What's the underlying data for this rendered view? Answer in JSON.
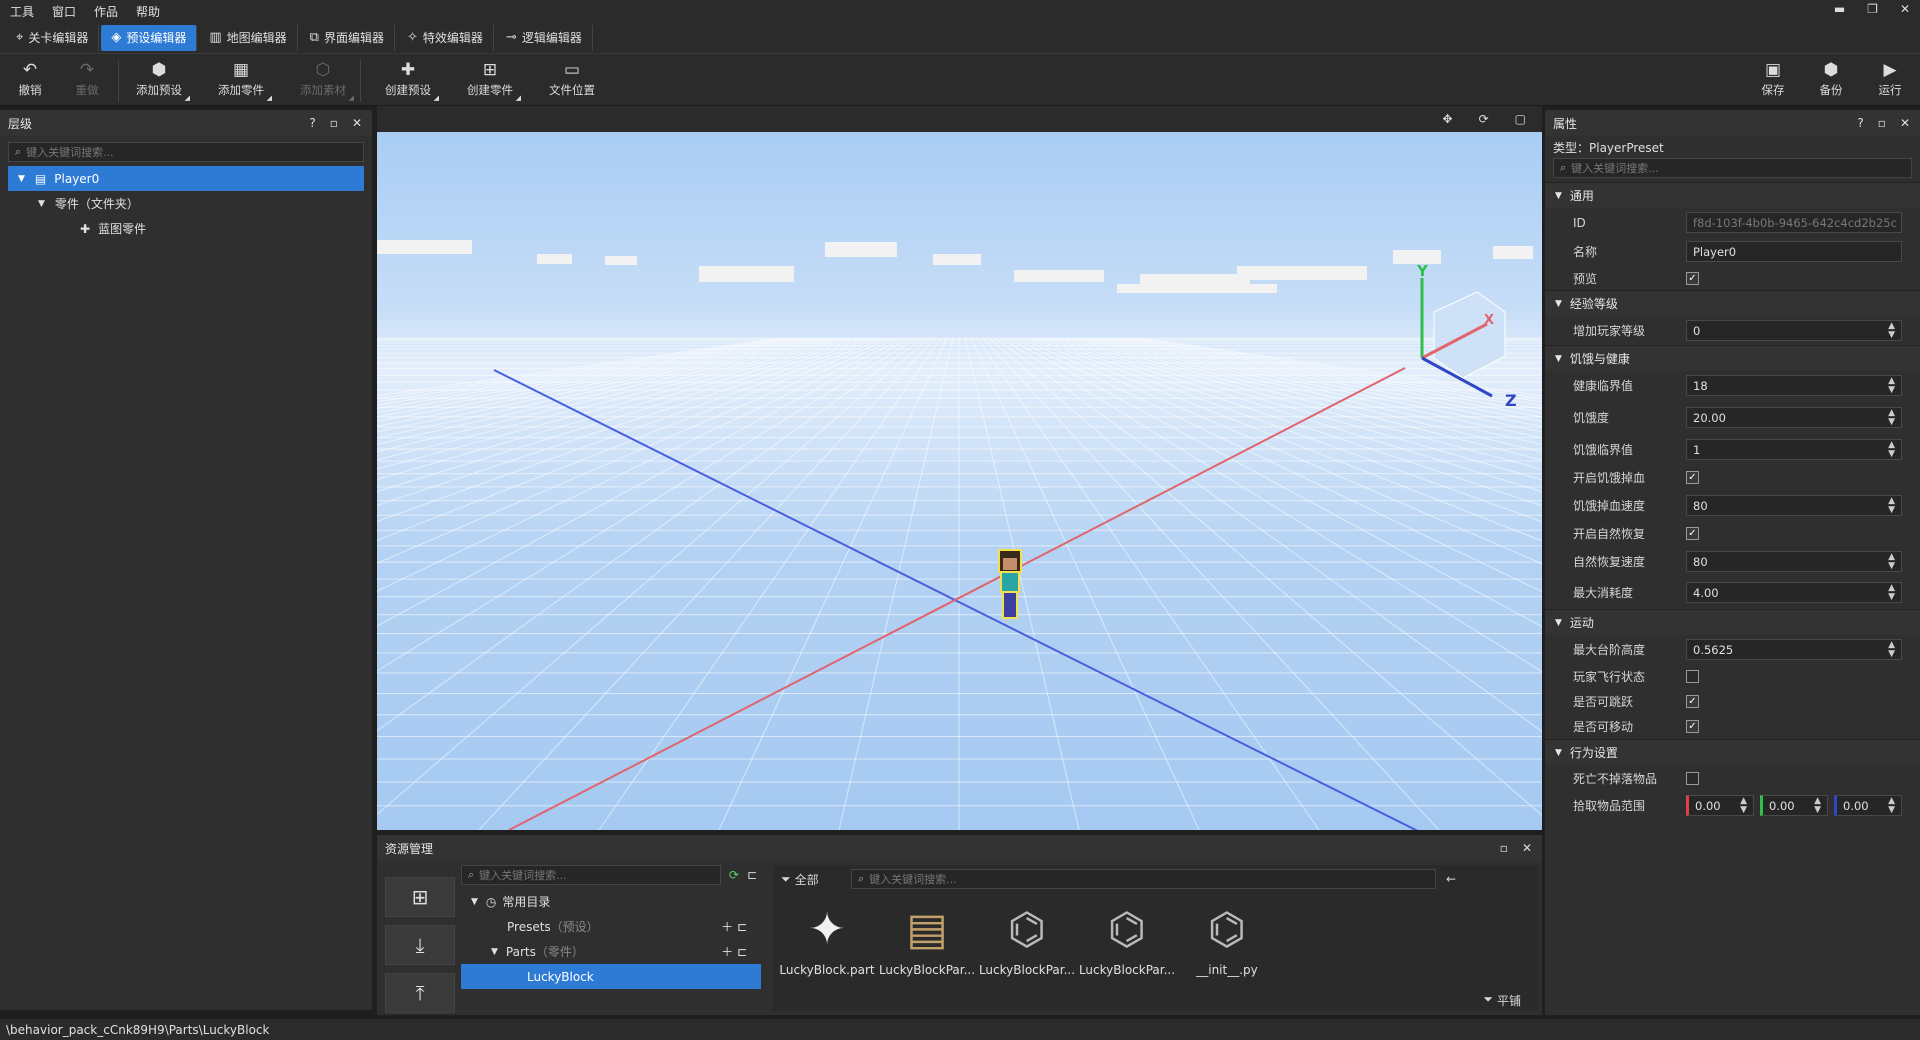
{
  "menubar": {
    "items": [
      "工具",
      "窗口",
      "作品",
      "帮助"
    ],
    "window_controls": [
      "▬",
      "❐",
      "✕"
    ]
  },
  "tabs": [
    {
      "label": "关卡编辑器",
      "icon": "level-editor-icon",
      "active": false
    },
    {
      "label": "预设编辑器",
      "icon": "preset-editor-icon",
      "active": true
    },
    {
      "label": "地图编辑器",
      "icon": "map-editor-icon",
      "active": false
    },
    {
      "label": "界面编辑器",
      "icon": "ui-editor-icon",
      "active": false
    },
    {
      "label": "特效编辑器",
      "icon": "effect-editor-icon",
      "active": false
    },
    {
      "label": "逻辑编辑器",
      "icon": "logic-editor-icon",
      "active": false
    }
  ],
  "toolbar": {
    "undo": "撤销",
    "redo": "重做",
    "add_preset": "添加预设",
    "add_part": "添加零件",
    "add_material": "添加素材",
    "create_preset": "创建预设",
    "create_part": "创建零件",
    "file_location": "文件位置",
    "save": "保存",
    "backup": "备份",
    "run": "运行"
  },
  "hierarchy": {
    "title": "层级",
    "search_placeholder": "键入关键词搜索...",
    "items": [
      {
        "label": "Player0",
        "level": 0,
        "selected": true
      },
      {
        "label": "零件（文件夹）",
        "level": 1,
        "selected": false
      },
      {
        "label": "蓝图零件",
        "level": 2,
        "selected": false
      }
    ]
  },
  "viewport": {
    "gizmo_labels": {
      "y": "Y",
      "x": "X",
      "z": "Z"
    }
  },
  "properties": {
    "title": "属性",
    "type_line": "类型：PlayerPreset",
    "search_placeholder": "键入关键词搜索...",
    "sections": {
      "general": "通用",
      "exp": "经验等级",
      "hunger": "饥饿与健康",
      "motion": "运动",
      "behavior": "行为设置"
    },
    "rows": {
      "id_label": "ID",
      "id_value": "f8d-103f-4b0b-9465-642c4cd2b25c",
      "name_label": "名称",
      "name_value": "Player0",
      "preview_label": "预览",
      "add_level_label": "增加玩家等级",
      "add_level_value": "0",
      "health_thr_label": "健康临界值",
      "health_thr_value": "18",
      "hunger_label": "饥饿度",
      "hunger_value": "20.00",
      "hunger_thr_label": "饥饿临界值",
      "hunger_thr_value": "1",
      "hunger_dmg_label": "开启饥饿掉血",
      "hunger_dmg_speed_label": "饥饿掉血速度",
      "hunger_dmg_speed_value": "80",
      "regen_label": "开启自然恢复",
      "regen_speed_label": "自然恢复速度",
      "regen_speed_value": "80",
      "max_exhaust_label": "最大消耗度",
      "max_exhaust_value": "4.00",
      "step_label": "最大台阶高度",
      "step_value": "0.5625",
      "fly_label": "玩家飞行状态",
      "jump_label": "是否可跳跃",
      "move_label": "是否可移动",
      "keep_label": "死亡不掉落物品",
      "pickup_label": "拾取物品范围",
      "pickup_x": "0.00",
      "pickup_y": "0.00",
      "pickup_z": "0.00"
    }
  },
  "resource": {
    "title": "资源管理",
    "search_placeholder": "键入关键词搜索...",
    "filter_all": "全部",
    "asset_search_placeholder": "键入关键词搜索...",
    "tile_label": "平铺",
    "tree": [
      {
        "label": "常用目录",
        "note": ""
      },
      {
        "label": "Presets",
        "note": "（预设）"
      },
      {
        "label": "Parts",
        "note": "（零件）"
      },
      {
        "label": "LuckyBlock",
        "note": ""
      }
    ],
    "assets": [
      "LuckyBlock.part",
      "LuckyBlockPar...",
      "LuckyBlockPar...",
      "LuckyBlockPar...",
      "__init__.py"
    ]
  },
  "statusbar": {
    "path": "\\behavior_pack_cCnk89H9\\Parts\\LuckyBlock"
  },
  "colors": {
    "accent": "#2e7bd6",
    "axis_x": "#e0656e",
    "axis_z": "#4a5fe0",
    "axis_y": "#2fbf4a"
  }
}
